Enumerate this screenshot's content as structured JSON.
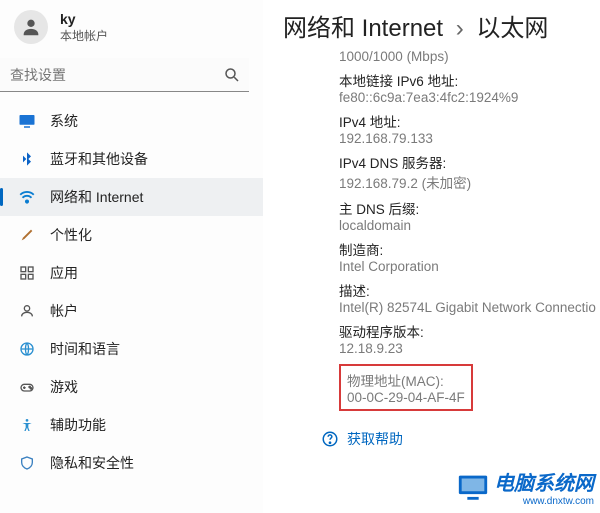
{
  "user": {
    "name": "ky",
    "account": "本地帐户"
  },
  "search": {
    "placeholder": "查找设置"
  },
  "nav": {
    "items": [
      {
        "label": "系统"
      },
      {
        "label": "蓝牙和其他设备"
      },
      {
        "label": "网络和 Internet"
      },
      {
        "label": "个性化"
      },
      {
        "label": "应用"
      },
      {
        "label": "帐户"
      },
      {
        "label": "时间和语言"
      },
      {
        "label": "游戏"
      },
      {
        "label": "辅助功能"
      },
      {
        "label": "隐私和安全性"
      }
    ]
  },
  "breadcrumb": {
    "a": "网络和 Internet",
    "sep": "›",
    "b": "以太网"
  },
  "details": {
    "speed_val": "1000/1000 (Mbps)",
    "ipv6ll_lbl": "本地链接 IPv6 地址:",
    "ipv6ll_val": "fe80::6c9a:7ea3:4fc2:1924%9",
    "ipv4_lbl": "IPv4 地址:",
    "ipv4_val": "192.168.79.133",
    "dns_lbl": "IPv4 DNS 服务器:",
    "dns_val": "192.168.79.2 (未加密)",
    "suffix_lbl": "主 DNS 后缀:",
    "suffix_val": "localdomain",
    "mfr_lbl": "制造商:",
    "mfr_val": "Intel Corporation",
    "desc_lbl": "描述:",
    "desc_val": "Intel(R) 82574L Gigabit Network Connectio",
    "drv_lbl": "驱动程序版本:",
    "drv_val": "12.18.9.23",
    "mac_lbl": "物理地址(MAC):",
    "mac_val": "00-0C-29-04-AF-4F"
  },
  "help": "获取帮助",
  "watermark": {
    "title": "电脑系统网",
    "url": "www.dnxtw.com"
  }
}
